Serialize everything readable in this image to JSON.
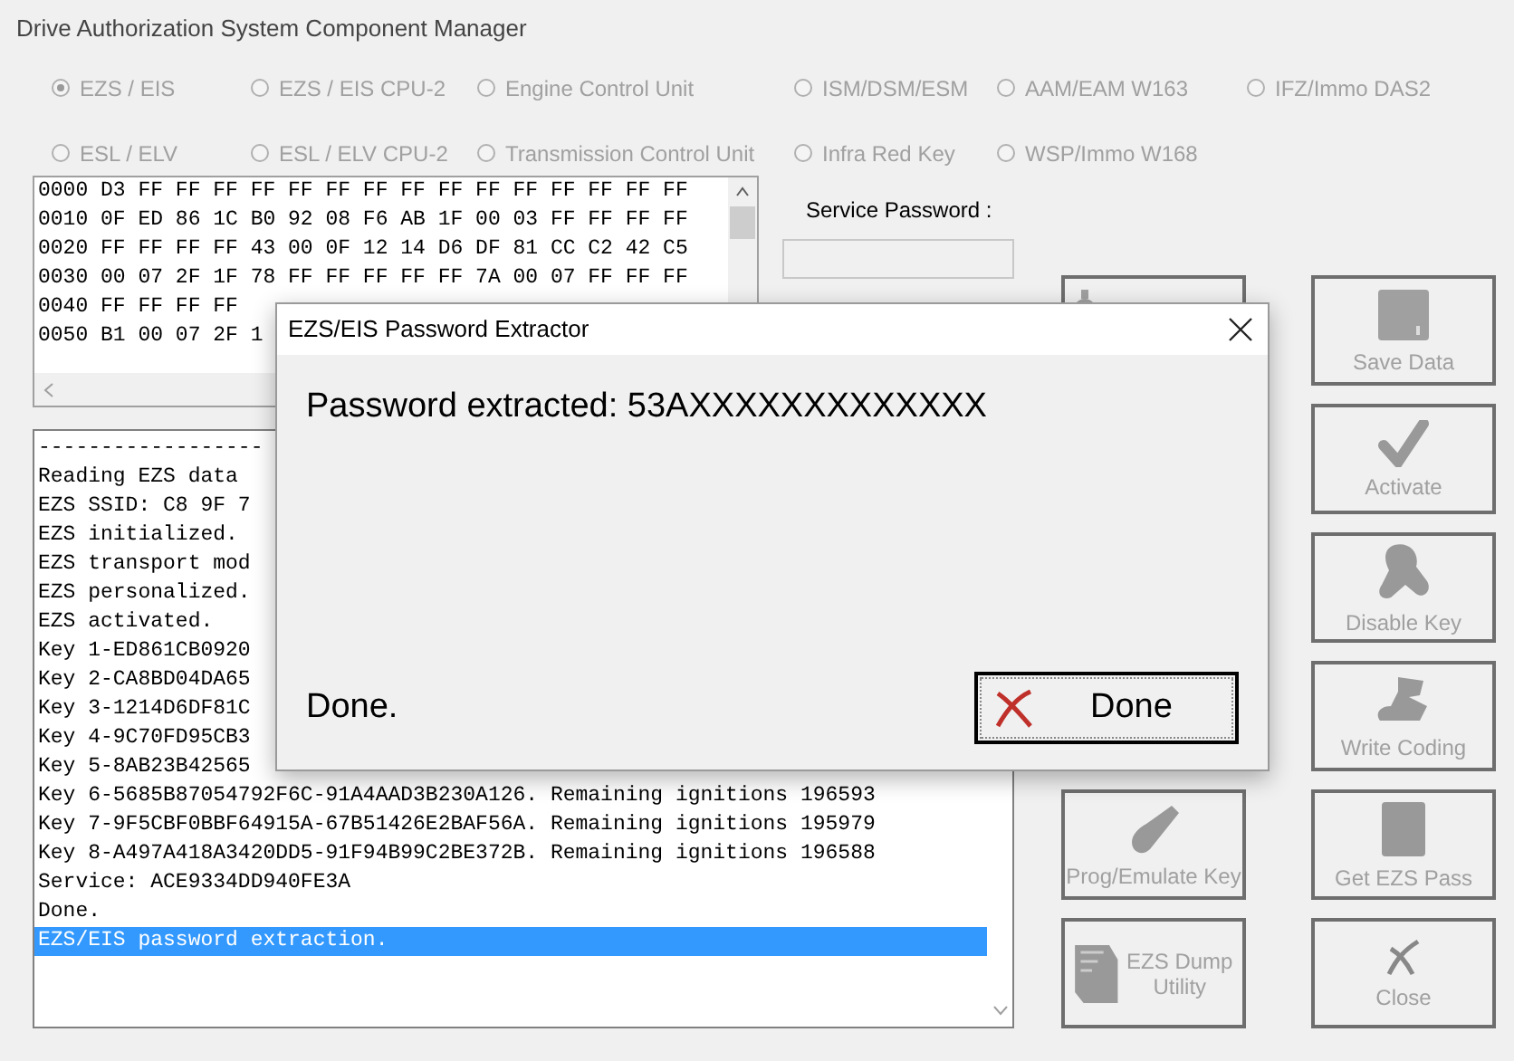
{
  "window": {
    "title": "Drive Authorization System Component Manager"
  },
  "radios": [
    {
      "label": "EZS / EIS",
      "selected": true
    },
    {
      "label": "EZS / EIS CPU-2",
      "selected": false
    },
    {
      "label": "Engine Control Unit",
      "selected": false
    },
    {
      "label": "ISM/DSM/ESM",
      "selected": false
    },
    {
      "label": "AAM/EAM W163",
      "selected": false
    },
    {
      "label": "IFZ/Immo DAS2",
      "selected": false
    },
    {
      "label": "ESL / ELV",
      "selected": false
    },
    {
      "label": "ESL / ELV CPU-2",
      "selected": false
    },
    {
      "label": "Transmission Control Unit",
      "selected": false
    },
    {
      "label": "Infra Red Key",
      "selected": false
    },
    {
      "label": "WSP/Immo W168",
      "selected": false
    }
  ],
  "hex_dump": {
    "lines": [
      "0000 D3 FF FF FF FF FF FF FF FF FF FF FF FF FF FF FF",
      "0010 0F ED 86 1C B0 92 08 F6 AB 1F 00 03 FF FF FF FF",
      "0020 FF FF FF FF 43 00 0F 12 14 D6 DF 81 CC C2 42 C5",
      "0030 00 07 2F 1F 78 FF FF FF FF FF 7A 00 07 FF FF FF",
      "0040 FF FF FF FF",
      "0050 B1 00 07 2F 1"
    ]
  },
  "service_password": {
    "label": "Service Password :"
  },
  "log": {
    "lines": [
      {
        "text": "------------------",
        "selected": false
      },
      {
        "text": "Reading EZS data",
        "selected": false
      },
      {
        "text": "EZS SSID: C8 9F 7",
        "selected": false
      },
      {
        "text": "EZS initialized.",
        "selected": false
      },
      {
        "text": "EZS transport mod",
        "selected": false
      },
      {
        "text": "EZS personalized.",
        "selected": false
      },
      {
        "text": "EZS activated.",
        "selected": false
      },
      {
        "text": "Key 1-ED861CB0920",
        "selected": false
      },
      {
        "text": "Key 2-CA8BD04DA65",
        "selected": false
      },
      {
        "text": "Key 3-1214D6DF81C",
        "selected": false
      },
      {
        "text": "Key 4-9C70FD95CB3",
        "selected": false
      },
      {
        "text": "Key 5-8AB23B42565",
        "selected": false
      },
      {
        "text": "Key 6-5685B87054792F6C-91A4AAD3B230A126. Remaining ignitions 196593",
        "selected": false
      },
      {
        "text": "Key 7-9F5CBF0BBF64915A-67B51426E2BAF56A. Remaining ignitions 195979",
        "selected": false
      },
      {
        "text": "Key 8-A497A418A3420DD5-91F94B99C2BE372B. Remaining ignitions 196588",
        "selected": false
      },
      {
        "text": "Service: ACE9334DD940FE3A",
        "selected": false
      },
      {
        "text": "Done.",
        "selected": false
      },
      {
        "text": "EZS/EIS password extraction.",
        "selected": true
      }
    ]
  },
  "buttons_left": [
    {
      "disabled": true
    },
    {
      "label": "Prog/Emulate Key",
      "disabled": true
    },
    {
      "label": "EZS Dump Utility",
      "disabled": true
    }
  ],
  "buttons_right": [
    {
      "label": "Save Data",
      "disabled": true
    },
    {
      "label": "Activate",
      "disabled": true
    },
    {
      "label": "Disable Key",
      "disabled": true
    },
    {
      "label": "Write Coding",
      "disabled": true
    },
    {
      "label": "Get EZS Pass",
      "disabled": true
    },
    {
      "label": "Close",
      "disabled": true
    }
  ],
  "dialog": {
    "title": "EZS/EIS Password Extractor",
    "message": "Password extracted: 53AXXXXXXXXXXXXX",
    "status": "Done.",
    "button": "Done"
  }
}
